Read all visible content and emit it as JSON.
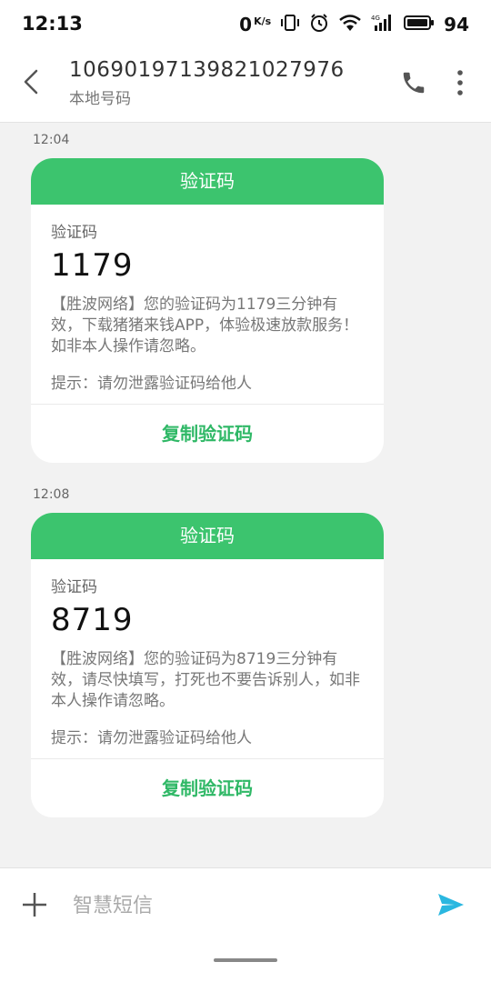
{
  "status_bar": {
    "time": "12:13",
    "net_speed_value": "0",
    "net_speed_unit": "K/s",
    "battery_level": "94",
    "icons": [
      "vibrate-icon",
      "alarm-icon",
      "wifi-icon",
      "signal-4g-icon",
      "battery-icon"
    ]
  },
  "header": {
    "contact_number": "10690197139821027976",
    "contact_subtitle": "本地号码",
    "icons": [
      "back-arrow-icon",
      "phone-icon",
      "more-vertical-icon"
    ]
  },
  "messages": [
    {
      "time": "12:04",
      "card_title": "验证码",
      "code_label": "验证码",
      "code": "1179",
      "body": "【胜波网络】您的验证码为1179三分钟有效，下载猪猪来钱APP，体验极速放款服务！如非本人操作请忽略。",
      "tip": "提示：请勿泄露验证码给他人",
      "copy_label": "复制验证码"
    },
    {
      "time": "12:08",
      "card_title": "验证码",
      "code_label": "验证码",
      "code": "8719",
      "body": "【胜波网络】您的验证码为8719三分钟有效，请尽快填写，打死也不要告诉别人，如非本人操作请忽略。",
      "tip": "提示：请勿泄露验证码给他人",
      "copy_label": "复制验证码"
    }
  ],
  "input_bar": {
    "placeholder": "智慧短信",
    "icons": [
      "plus-icon",
      "send-icon"
    ]
  },
  "colors": {
    "accent_green": "#3cc46e",
    "copy_green": "#2fb866",
    "send_blue": "#2ab7e0"
  }
}
